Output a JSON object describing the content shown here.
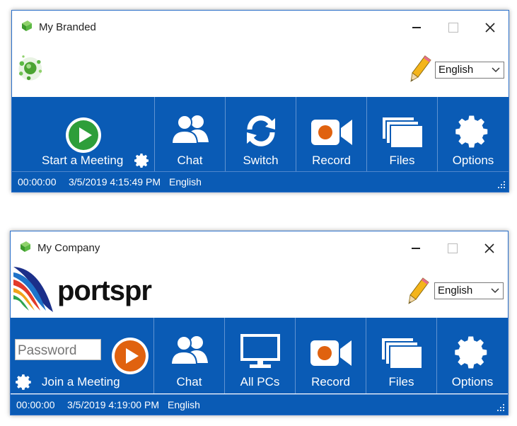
{
  "window1": {
    "title": "My Branded",
    "language": "English",
    "buttons": {
      "start": "Start a Meeting",
      "chat": "Chat",
      "switch": "Switch",
      "record": "Record",
      "files": "Files",
      "options": "Options"
    },
    "status": {
      "elapsed": "00:00:00",
      "datetime": "3/5/2019 4:15:49 PM",
      "lang": "English"
    }
  },
  "window2": {
    "title": "My Company",
    "brand": "portspr",
    "language": "English",
    "password_placeholder": "Password",
    "buttons": {
      "join": "Join a Meeting",
      "chat": "Chat",
      "allpcs": "All PCs",
      "record": "Record",
      "files": "Files",
      "options": "Options"
    },
    "status": {
      "elapsed": "00:00:00",
      "datetime": "3/5/2019 4:19:00 PM",
      "lang": "English"
    }
  },
  "colors": {
    "toolbar": "#0a5bb5",
    "play_green": "#2e9e3a",
    "play_orange": "#e0620f",
    "record_dot": "#e0620f"
  }
}
